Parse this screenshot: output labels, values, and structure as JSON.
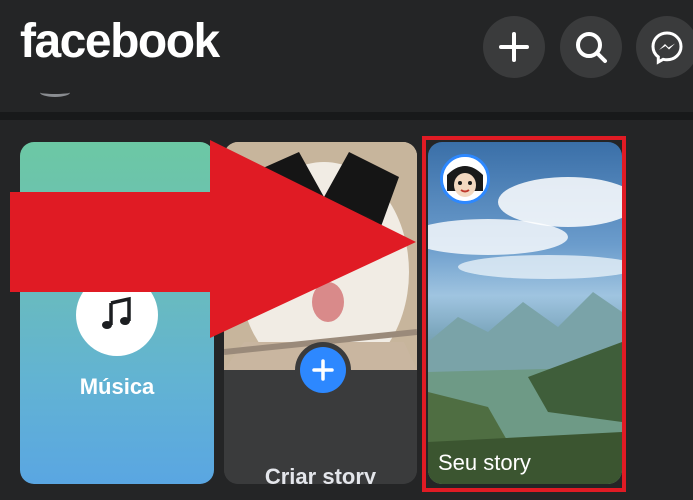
{
  "header": {
    "logo": "facebook",
    "buttons": [
      {
        "name": "create",
        "icon": "plus-icon"
      },
      {
        "name": "search",
        "icon": "search-icon"
      },
      {
        "name": "messenger",
        "icon": "messenger-icon"
      }
    ]
  },
  "stories": {
    "music": {
      "label": "Música",
      "icon": "music-note-icon",
      "gradient": [
        "#6cc8a4",
        "#5aa6e2"
      ]
    },
    "create": {
      "label": "Criar story",
      "icon": "plus-icon",
      "accent": "#2d88ff"
    },
    "yours": {
      "label": "Seu story"
    }
  },
  "annotation": {
    "arrow_color": "#e01b24",
    "highlight_color": "#e01b24"
  },
  "colors": {
    "background": "#242526",
    "divider": "#18191a",
    "card": "#3a3b3c"
  }
}
